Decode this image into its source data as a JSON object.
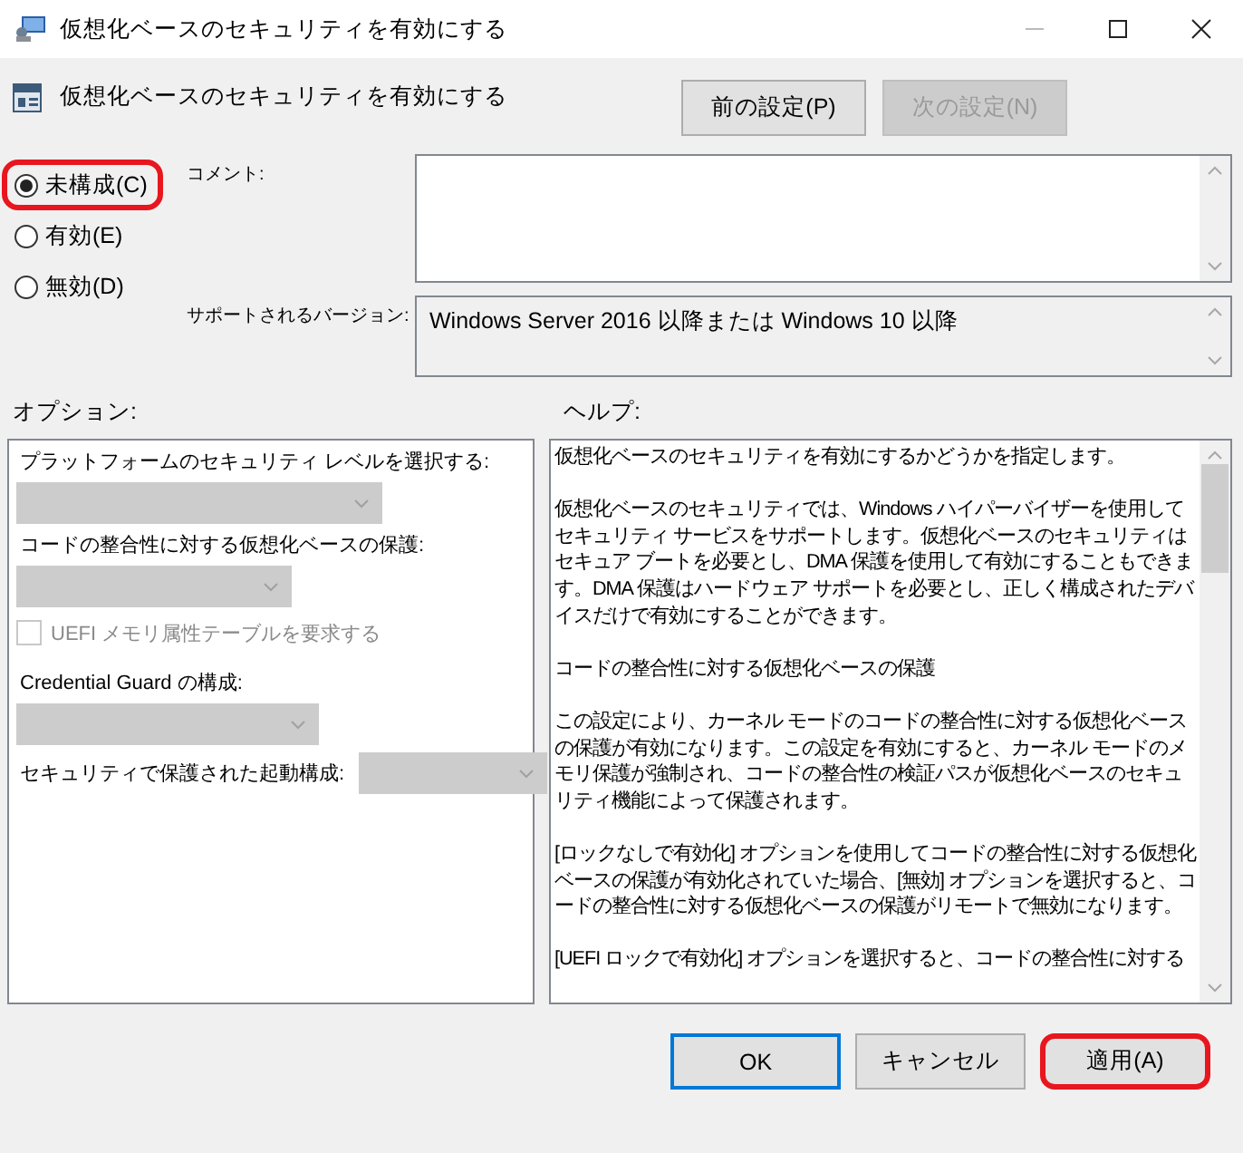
{
  "window": {
    "title": "仮想化ベースのセキュリティを有効にする"
  },
  "header": {
    "title": "仮想化ベースのセキュリティを有効にする"
  },
  "nav_buttons": [
    {
      "label": "前の設定(P)",
      "disabled": false
    },
    {
      "label": "次の設定(N)",
      "disabled": true
    }
  ],
  "state_options": [
    {
      "label": "未構成(C)",
      "selected": true,
      "highlighted": true
    },
    {
      "label": "有効(E)",
      "selected": false,
      "highlighted": false
    },
    {
      "label": "無効(D)",
      "selected": false,
      "highlighted": false
    }
  ],
  "comment": {
    "label": "コメント:"
  },
  "supported": {
    "label": "サポートされるバージョン:",
    "value": "Windows Server 2016 以降または Windows 10 以降"
  },
  "options": {
    "label": "オプション:",
    "items": [
      {
        "kind": "dropdown",
        "label": "プラットフォームのセキュリティ レベルを選択する:",
        "disabled": true
      },
      {
        "kind": "dropdown",
        "label": "コードの整合性に対する仮想化ベースの保護:",
        "disabled": true
      },
      {
        "kind": "checkbox",
        "label": "UEFI メモリ属性テーブルを要求する",
        "checked": false,
        "disabled": true
      },
      {
        "kind": "dropdown",
        "label": "Credential  Guard の構成:",
        "disabled": true
      },
      {
        "kind": "inline-dropdown",
        "label": "セキュリティで保護された起動構成:",
        "disabled": true
      }
    ]
  },
  "help": {
    "label": "ヘルプ:",
    "paragraphs": [
      "仮想化ベースのセキュリティを有効にするかどうかを指定します。",
      "仮想化ベースのセキュリティでは、Windows ハイパーバイザーを使用してセキュリティ サービスをサポートします。仮想化ベースのセキュリティはセキュア ブートを必要とし、DMA 保護を使用して有効にすることもできます。DMA 保護はハードウェア サポートを必要とし、正しく構成されたデバイスだけで有効にすることができます。",
      "コードの整合性に対する仮想化ベースの保護",
      "この設定により、カーネル モードのコードの整合性に対する仮想化ベースの保護が有効になります。この設定を有効にすると、カーネル モードのメモリ保護が強制され、コードの整合性の検証パスが仮想化ベースのセキュリティ機能によって保護されます。",
      "[ロックなしで有効化] オプションを使用してコードの整合性に対する仮想化ベースの保護が有効化されていた場合、[無効] オプションを選択すると、コードの整合性に対する仮想化ベースの保護がリモートで無効になります。",
      "[UEFI ロックで有効化] オプションを選択すると、コードの整合性に対する"
    ]
  },
  "buttons": [
    {
      "label": "OK",
      "default": true,
      "highlighted": false
    },
    {
      "label": "キャンセル",
      "default": false,
      "highlighted": false
    },
    {
      "label": "適用(A)",
      "default": false,
      "highlighted": true
    }
  ]
}
